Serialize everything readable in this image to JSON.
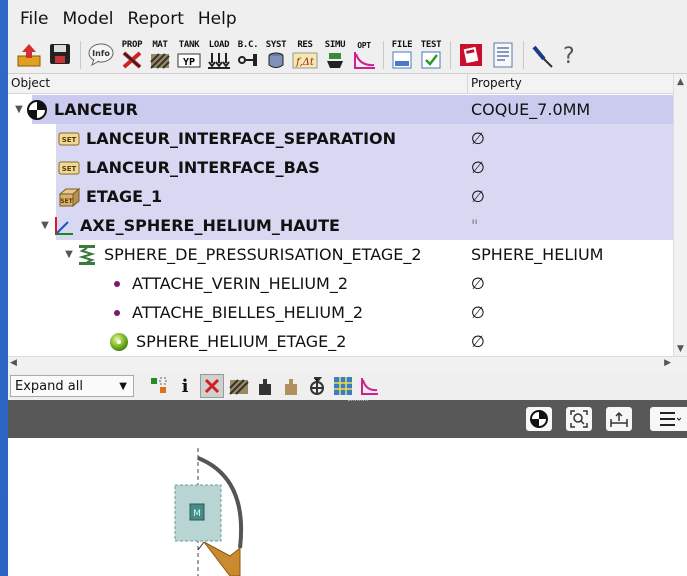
{
  "menu": [
    "File",
    "Model",
    "Report",
    "Help"
  ],
  "toolbar": {
    "info": "Info",
    "prop": "PROP",
    "mat": "MAT",
    "tank": "TANK",
    "load": "LOAD",
    "bc": "B.C.",
    "syst": "SYST",
    "res": "RES",
    "simu": "SIMU",
    "opt": "OPT",
    "file": "FILE",
    "test": "TEST"
  },
  "tree": {
    "col_object": "Object",
    "col_property": "Property",
    "rows": [
      {
        "label": "LANCEUR",
        "property": "COQUE_7.0MM",
        "icon": "center-of-mass-icon"
      },
      {
        "label": "LANCEUR_INTERFACE_SEPARATION",
        "property": "∅",
        "icon": "set-icon",
        "icon_text": "SET"
      },
      {
        "label": "LANCEUR_INTERFACE_BAS",
        "property": "∅",
        "icon": "set-icon",
        "icon_text": "SET"
      },
      {
        "label": "ETAGE_1",
        "property": "∅",
        "icon": "box-set-icon",
        "icon_text": "SET"
      },
      {
        "label": "AXE_SPHERE_HELIUM_HAUTE",
        "property": "\"",
        "icon": "axis-icon"
      },
      {
        "label": "SPHERE_DE_PRESSURISATION_ETAGE_2",
        "property": "SPHERE_HELIUM",
        "icon": "spring-icon"
      },
      {
        "label": "ATTACHE_VERIN_HELIUM_2",
        "property": "∅",
        "icon": "point-icon"
      },
      {
        "label": "ATTACHE_BIELLES_HELIUM_2",
        "property": "∅",
        "icon": "point-icon"
      },
      {
        "label": "SPHERE_HELIUM_ETAGE_2",
        "property": "∅",
        "icon": "sphere-icon"
      }
    ]
  },
  "filter": {
    "combo_value": "Expand all",
    "info_glyph": "i"
  },
  "colors": {
    "selection": "#d8d8f3",
    "viewer_bar": "#585858",
    "desktop": "#2a62c2"
  }
}
